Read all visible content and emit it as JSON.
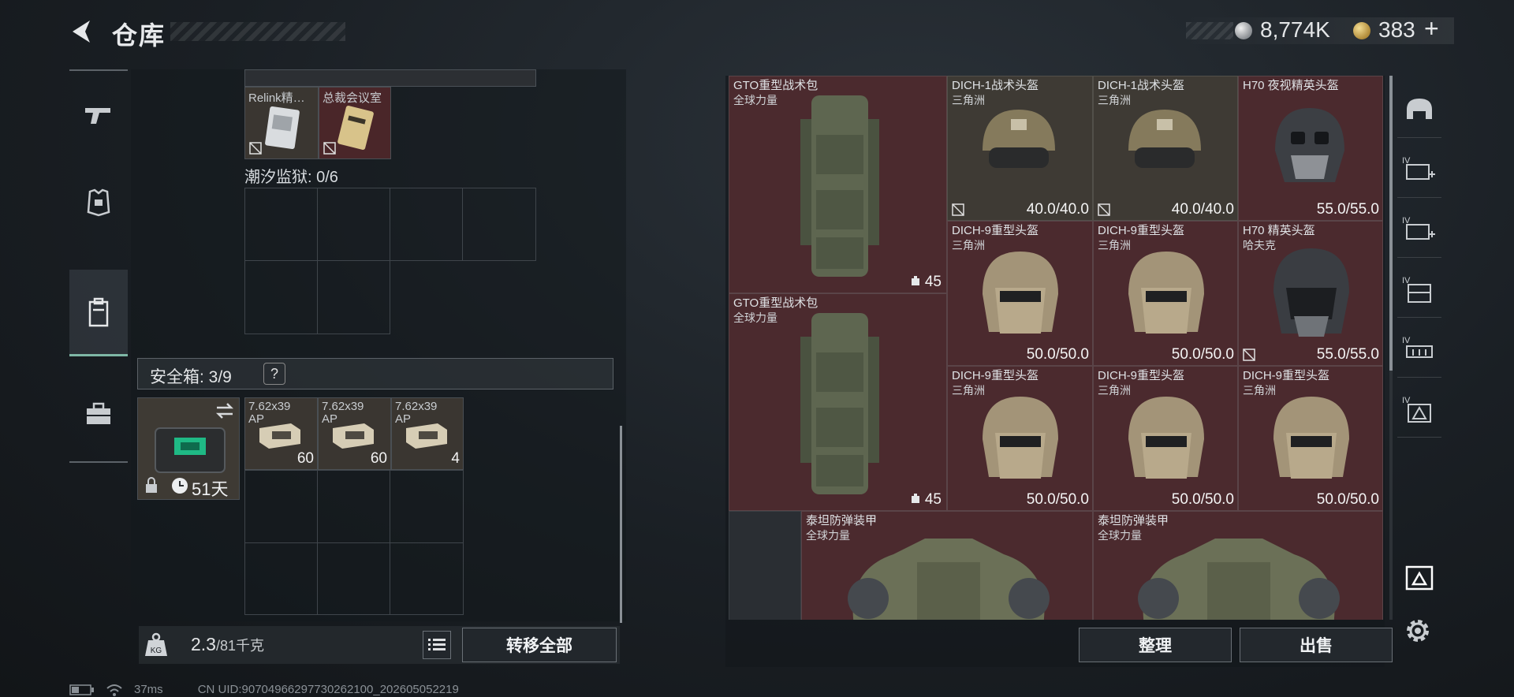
{
  "header": {
    "title": "仓库",
    "currency": {
      "silver": "8,774K",
      "gold": "383",
      "add": "+"
    }
  },
  "left_nav": [
    "weapon-icon",
    "armor-icon",
    "backpack-icon",
    "case-icon"
  ],
  "left_panel": {
    "top_items": [
      {
        "name": "Relink精…"
      },
      {
        "name": "总裁会议室"
      }
    ],
    "prison_label": "潮汐监狱: 0/6",
    "safebox_label": "安全箱: 3/9",
    "safebox_help": "?",
    "safebox_days": "51天",
    "ammo": [
      {
        "name": "7.62x39",
        "sub": "AP",
        "count": "60"
      },
      {
        "name": "7.62x39",
        "sub": "AP",
        "count": "60"
      },
      {
        "name": "7.62x39",
        "sub": "AP",
        "count": "4"
      }
    ],
    "weight_value": "2.3",
    "weight_unit": "/81千克",
    "transfer_label": "转移全部"
  },
  "stash": {
    "items": [
      {
        "name": "GTO重型战术包",
        "sub": "全球力量",
        "capacity": "45"
      },
      {
        "name": "GTO重型战术包",
        "sub": "全球力量",
        "capacity": "45"
      },
      {
        "name": "DICH-1战术头盔",
        "sub": "三角洲",
        "durability": "40.0/40.0"
      },
      {
        "name": "DICH-1战术头盔",
        "sub": "三角洲",
        "durability": "40.0/40.0"
      },
      {
        "name": "H70 夜视精英头盔",
        "sub": "",
        "durability": "55.0/55.0"
      },
      {
        "name": "DICH-9重型头盔",
        "sub": "三角洲",
        "durability": "50.0/50.0"
      },
      {
        "name": "DICH-9重型头盔",
        "sub": "三角洲",
        "durability": "50.0/50.0"
      },
      {
        "name": "H70 精英头盔",
        "sub": "哈夫克",
        "durability": "55.0/55.0"
      },
      {
        "name": "DICH-9重型头盔",
        "sub": "三角洲",
        "durability": "50.0/50.0"
      },
      {
        "name": "DICH-9重型头盔",
        "sub": "三角洲",
        "durability": "50.0/50.0"
      },
      {
        "name": "DICH-9重型头盔",
        "sub": "三角洲",
        "durability": "50.0/50.0"
      },
      {
        "name": "泰坦防弹装甲",
        "sub": "全球力量"
      },
      {
        "name": "泰坦防弹装甲",
        "sub": "全球力量"
      }
    ],
    "organize_label": "整理",
    "sell_label": "出售"
  },
  "right_nav": [
    "helmet-filter-icon",
    "armor-filter-icon",
    "chest-rig-filter-icon",
    "backpack-filter-icon",
    "rig-filter-icon",
    "container-filter-icon",
    "case-filter-icon"
  ],
  "right_nav_tiers": [
    "IV",
    "IV",
    "IV",
    "IV",
    "IV"
  ],
  "status": {
    "ping": "37ms",
    "uid": "CN UID:9070496629773026210​0_202605052219"
  },
  "colors": {
    "rare_bg": "#4b2a2e",
    "common_bg": "#3e3a34",
    "accent": "#7fb7a6"
  }
}
